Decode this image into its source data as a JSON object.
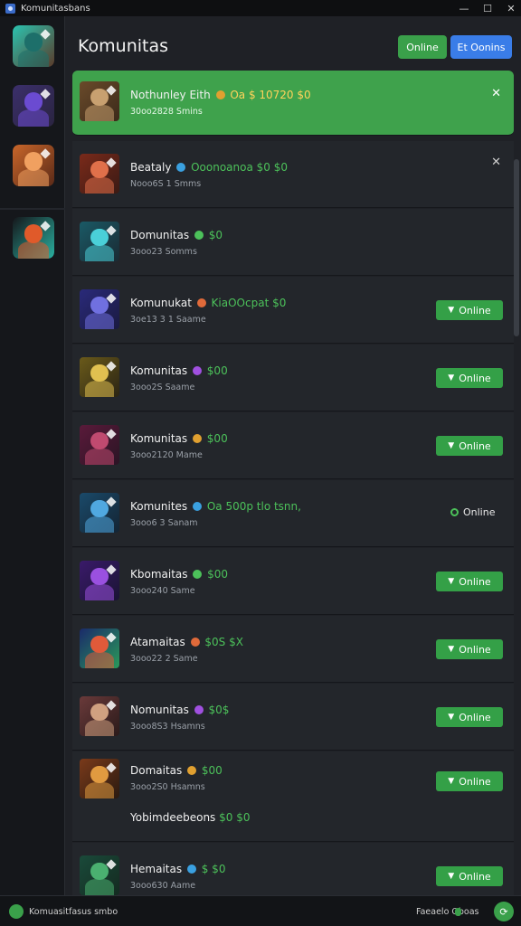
{
  "window": {
    "title": "Komunitasbans"
  },
  "titlebar_controls": {
    "minimize": "—",
    "maximize": "☐",
    "close": "✕"
  },
  "sidebar": {
    "items": [
      {
        "name": "sidebar-item-1",
        "colors": [
          "#2bc3b0",
          "#1d6f6a",
          "#5a3b2a"
        ]
      },
      {
        "name": "sidebar-item-2",
        "colors": [
          "#3b2f6b",
          "#6b4bd1",
          "#2a2440"
        ]
      },
      {
        "name": "sidebar-item-3",
        "colors": [
          "#c8662a",
          "#f0a060",
          "#5a2a18"
        ]
      },
      {
        "name": "sidebar-item-4",
        "colors": [
          "#15171b",
          "#e05a2a",
          "#2ab0a0"
        ]
      }
    ]
  },
  "header": {
    "title": "Komunitas",
    "btn_online": "Online",
    "btn_blue": "Et Oonins"
  },
  "rows": [
    {
      "title": "Nothunley Eith",
      "extra": "Oa $ 10720 $0",
      "sub": "30oo2828 Smins",
      "active": true,
      "status": "close",
      "colors": [
        "#6a4a2a",
        "#c8a070",
        "#3b2a1a"
      ]
    },
    {
      "title": "Beataly",
      "extra": "Ooonoanoa $0 $0",
      "sub": "Nooo6S 1 Smms",
      "status": "close",
      "colors": [
        "#7a2a1a",
        "#e0704a",
        "#3a1a14"
      ]
    },
    {
      "title": "Domunitas",
      "extra": "$0",
      "sub": "3ooo23 Somms",
      "status": "none",
      "colors": [
        "#1a5a66",
        "#4ad0d8",
        "#1a2a33"
      ]
    },
    {
      "title": "Komunukat",
      "extra": "KiaOOcpat $0",
      "sub": "3oe13 3 1 Saame",
      "status": "btn",
      "status_text": "Online",
      "colors": [
        "#2a2a7a",
        "#7070e0",
        "#1a1a40"
      ]
    },
    {
      "title": "Komunitas",
      "extra": "$00",
      "sub": "3ooo2S Saame",
      "status": "btn",
      "status_text": "Online",
      "colors": [
        "#6a5a1a",
        "#e0c050",
        "#2a2414"
      ]
    },
    {
      "title": "Komunitas",
      "extra": "$00",
      "sub": "3ooo2120 Mame",
      "status": "btn",
      "status_text": "Online",
      "colors": [
        "#5a1a3a",
        "#c04a70",
        "#2a1424"
      ]
    },
    {
      "title": "Komunites",
      "extra": "Oa 500p tlo tsnn,",
      "sub": "3ooo6 3 Sanam",
      "status": "plain",
      "status_text": "Online",
      "colors": [
        "#1a4a6a",
        "#50a8e0",
        "#142433"
      ]
    },
    {
      "title": "Kbomaitas",
      "extra": "$00",
      "sub": "3ooo240 Same",
      "status": "btn",
      "status_text": "Online",
      "colors": [
        "#3a1a6a",
        "#9a50e0",
        "#1a1433"
      ]
    },
    {
      "title": "Atamaitas",
      "extra": "$0S $X",
      "sub": "3ooo22 2 Same",
      "status": "btn",
      "status_text": "Online",
      "colors": [
        "#1a2a6a",
        "#e05a3a",
        "#2a9a5a"
      ]
    },
    {
      "title": "Nomunitas",
      "extra": "$0$",
      "sub": "3ooo8S3 Hsamns",
      "status": "btn",
      "status_text": "Online",
      "colors": [
        "#6a3a3a",
        "#d0a080",
        "#2a1a1a"
      ]
    },
    {
      "title": "Domaitas",
      "extra": "$00",
      "sub": "3ooo2S0 Hsamns",
      "sub2_title": "Yobimdeebeons",
      "sub2_extra": "$0 $0",
      "status": "btn",
      "status_text": "Online",
      "tall": true,
      "colors": [
        "#7a3a1a",
        "#e09a40",
        "#2a1a10"
      ]
    },
    {
      "title": "Hemaitas",
      "extra": "$ $0",
      "sub": "3ooo630 Aame",
      "status": "btn",
      "status_text": "Online",
      "colors": [
        "#1a4a3a",
        "#4ab070",
        "#142a20"
      ]
    }
  ],
  "footer": {
    "left_text": "Komuasitfasus smbo",
    "right_text": "Faeaelo Oboas"
  }
}
